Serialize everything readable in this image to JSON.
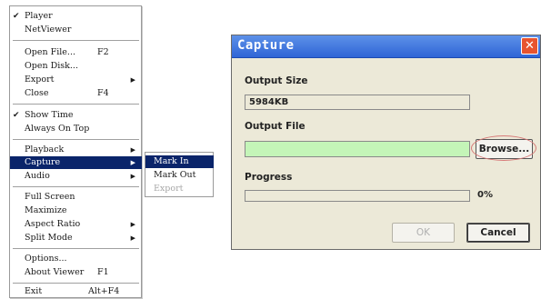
{
  "context_menu": {
    "items": [
      {
        "label": "Player",
        "checked": true
      },
      {
        "label": "NetViewer"
      },
      {
        "label": "Open File...",
        "shortcut": "F2"
      },
      {
        "label": "Open Disk..."
      },
      {
        "label": "Export",
        "submenu": true
      },
      {
        "label": "Close",
        "shortcut": "F4"
      },
      {
        "label": "Show Time",
        "checked": true
      },
      {
        "label": "Always On Top"
      },
      {
        "label": "Playback",
        "submenu": true
      },
      {
        "label": "Capture",
        "submenu": true,
        "highlighted": true
      },
      {
        "label": "Audio",
        "submenu": true
      },
      {
        "label": "Full Screen"
      },
      {
        "label": "Maximize"
      },
      {
        "label": "Aspect Ratio",
        "submenu": true
      },
      {
        "label": "Split Mode",
        "submenu": true
      },
      {
        "label": "Options..."
      },
      {
        "label": "About Viewer",
        "shortcut": "F1"
      },
      {
        "label": "Exit",
        "shortcut": "Alt+F4"
      }
    ],
    "check_glyph": "✔",
    "arrow_glyph": "▶"
  },
  "capture_submenu": {
    "items": [
      {
        "label": "Mark In",
        "highlighted": true
      },
      {
        "label": "Mark Out"
      },
      {
        "label": "Export",
        "disabled": true
      }
    ]
  },
  "dialog": {
    "title": "Capture",
    "close_glyph": "✕",
    "output_size_label": "Output Size",
    "output_size_value": "5984KB",
    "output_file_label": "Output File",
    "output_file_value": "",
    "browse_label": "Browse...",
    "progress_label": "Progress",
    "progress_text": "0%",
    "progress_value": 0,
    "ok_label": "OK",
    "cancel_label": "Cancel"
  },
  "colors": {
    "menu_highlight": "#0a246a",
    "title_bar": "#2f65d6",
    "file_field_bg": "#c4f5b8",
    "dialog_bg": "#ece9d8",
    "close_button": "#e8542f",
    "browse_ellipse": "#d77a78"
  }
}
